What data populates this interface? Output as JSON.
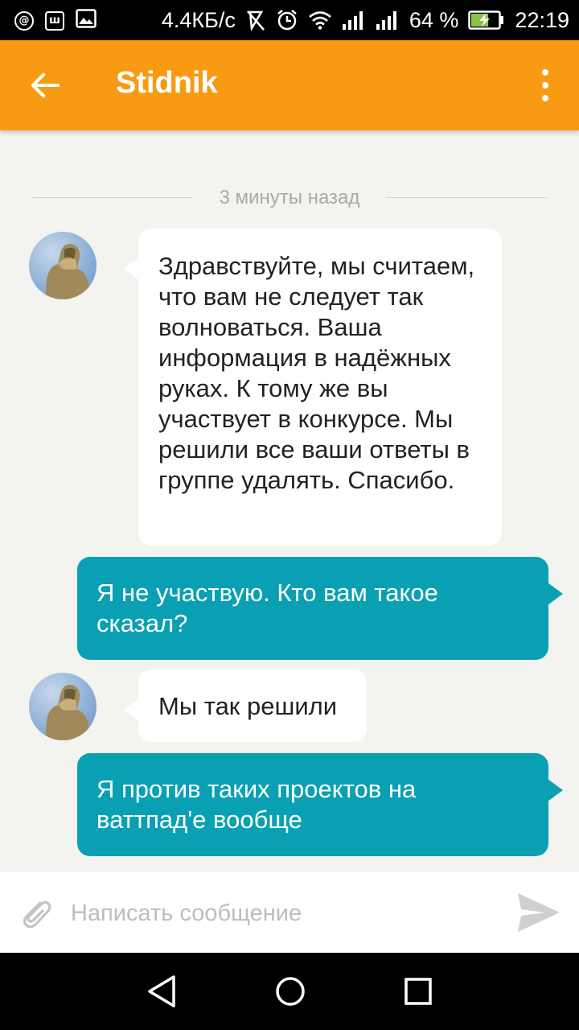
{
  "status_bar": {
    "speed": "4.4КБ/с",
    "battery_percent": "64 %",
    "battery_level": 0.64,
    "time": "22:19",
    "left_icons": [
      "vpn-icon",
      "app-notification-icon",
      "image-icon"
    ]
  },
  "header": {
    "title": "Stidnik",
    "back_icon": "arrow-left-icon",
    "menu_icon": "more-vert-icon",
    "color": "#f89a12"
  },
  "chat": {
    "time_divider": "3 минуты назад",
    "messages": [
      {
        "direction": "incoming",
        "text": "Здравствуйте, мы считаем, что вам не следует так волноваться. Ваша информация в надёжных руках. К тому же вы участвует в конкурсе. Мы решили все ваши ответы в группе удалять. Спасибо."
      },
      {
        "direction": "outgoing",
        "text": "Я не участвую. Кто вам такое сказал?"
      },
      {
        "direction": "incoming",
        "text": "Мы так решили"
      },
      {
        "direction": "outgoing",
        "text": "Я против таких проектов на ваттпад'е вообще"
      }
    ],
    "outgoing_color": "#0aa0b4"
  },
  "composer": {
    "placeholder": "Написать сообщение",
    "value": "",
    "attach_icon": "paperclip-icon",
    "send_icon": "send-icon"
  },
  "nav_bar": {
    "buttons": [
      "back-triangle-icon",
      "home-circle-icon",
      "recents-square-icon"
    ]
  }
}
